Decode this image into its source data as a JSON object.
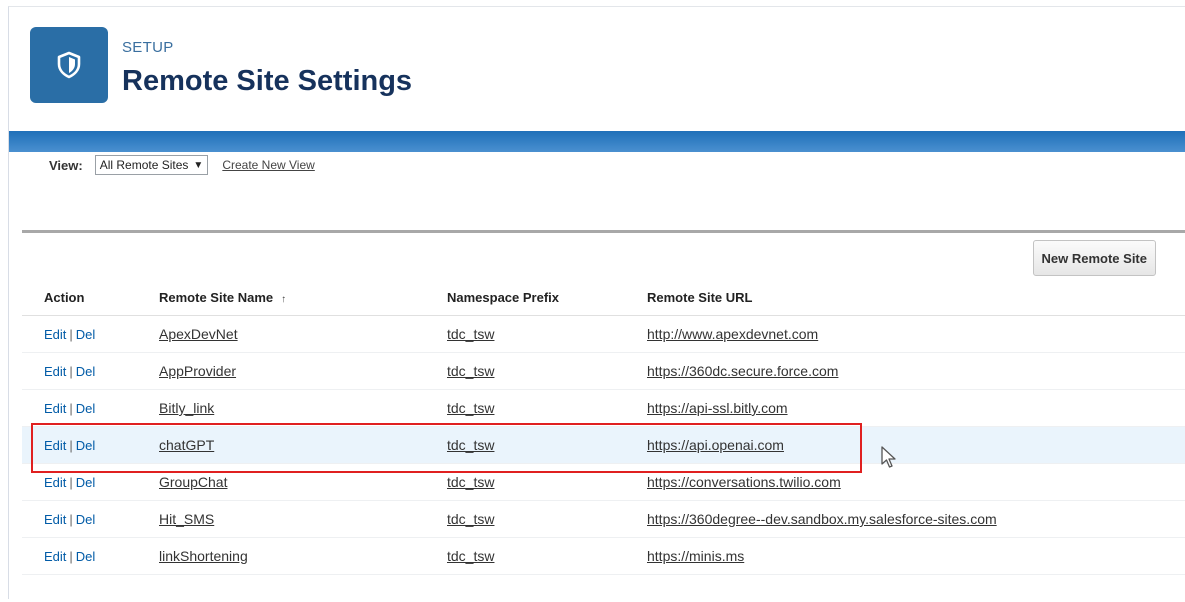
{
  "header": {
    "breadcrumb": "SETUP",
    "title": "Remote Site Settings",
    "logo_icon": "shield-icon",
    "logo_color": "#2a6ea6"
  },
  "view_bar": {
    "label": "View:",
    "selected": "All Remote Sites",
    "create_link": "Create New View"
  },
  "list": {
    "new_button": "New Remote Site",
    "columns": [
      "Action",
      "Remote Site Name",
      "Namespace Prefix",
      "Remote Site URL"
    ],
    "sort_indicator": "↑",
    "edit_label": "Edit",
    "del_label": "Del",
    "rows": [
      {
        "name": "ApexDevNet",
        "ns": "tdc_tsw",
        "url": "http://www.apexdevnet.com"
      },
      {
        "name": "AppProvider",
        "ns": "tdc_tsw",
        "url": "https://360dc.secure.force.com"
      },
      {
        "name": "Bitly_link",
        "ns": "tdc_tsw",
        "url": "https://api-ssl.bitly.com"
      },
      {
        "name": "chatGPT",
        "ns": "tdc_tsw",
        "url": "https://api.openai.com"
      },
      {
        "name": "GroupChat",
        "ns": "tdc_tsw",
        "url": "https://conversations.twilio.com"
      },
      {
        "name": "Hit_SMS",
        "ns": "tdc_tsw",
        "url": "https://360degree--dev.sandbox.my.salesforce-sites.com"
      },
      {
        "name": "linkShortening",
        "ns": "tdc_tsw",
        "url": "https://minis.ms"
      }
    ]
  },
  "colors": {
    "accent_bar": "#1f6fb8",
    "highlight_border": "#e02020",
    "row_highlight": "#eaf4fc",
    "link": "#015ba7"
  }
}
